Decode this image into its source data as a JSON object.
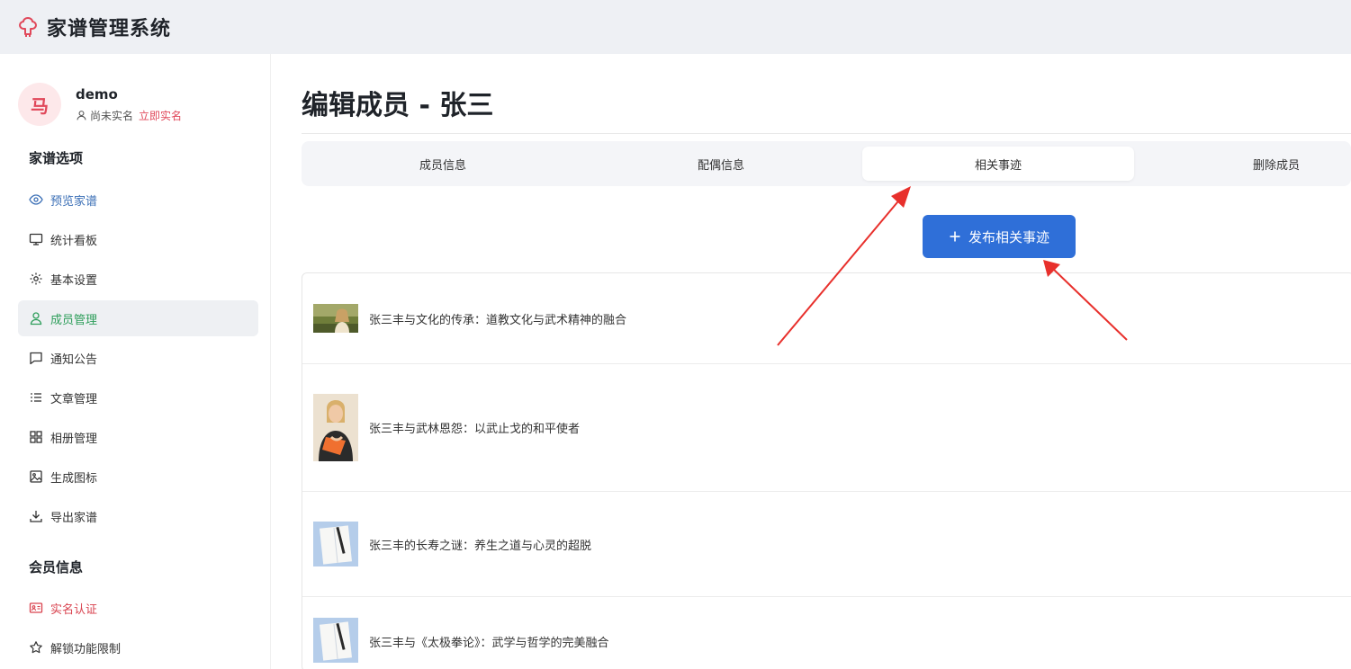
{
  "app": {
    "title": "家谱管理系统",
    "accent": "#e0485a"
  },
  "user": {
    "avatar_char": "马",
    "name": "demo",
    "verify_status": "尚未实名",
    "verify_link": "立即实名"
  },
  "sidebar": {
    "section1_title": "家谱选项",
    "items": [
      {
        "label": "预览家谱",
        "icon": "eye-icon"
      },
      {
        "label": "统计看板",
        "icon": "monitor-icon"
      },
      {
        "label": "基本设置",
        "icon": "gear-icon"
      },
      {
        "label": "成员管理",
        "icon": "user-icon",
        "active": true
      },
      {
        "label": "通知公告",
        "icon": "message-icon"
      },
      {
        "label": "文章管理",
        "icon": "list-icon"
      },
      {
        "label": "相册管理",
        "icon": "grid-icon"
      },
      {
        "label": "生成图标",
        "icon": "image-icon"
      },
      {
        "label": "导出家谱",
        "icon": "download-icon"
      }
    ],
    "section2_title": "会员信息",
    "member_items": [
      {
        "label": "实名认证",
        "icon": "id-card-icon"
      },
      {
        "label": "解锁功能限制",
        "icon": "star-icon"
      }
    ]
  },
  "main": {
    "page_title": "编辑成员 - 张三",
    "tabs": [
      {
        "label": "成员信息"
      },
      {
        "label": "配偶信息"
      },
      {
        "label": "相关事迹",
        "active": true
      },
      {
        "label": "删除成员"
      }
    ],
    "publish_button": "发布相关事迹",
    "stories": [
      {
        "title": "张三丰与文化的传承：道教文化与武术精神的融合",
        "thumb": "woman-field-photo"
      },
      {
        "title": "张三丰与武林恩怨：以武止戈的和平使者",
        "thumb": "woman-portrait-photo"
      },
      {
        "title": "张三丰的长寿之谜：养生之道与心灵的超脱",
        "thumb": "notebook-photo"
      },
      {
        "title": "张三丰与《太极拳论》：武学与哲学的完美融合",
        "thumb": "notebook-photo"
      }
    ]
  },
  "colors": {
    "primary_button": "#2f6fd8",
    "active_menu": "#2e9e5b",
    "annotation_arrow": "#e8302c"
  }
}
